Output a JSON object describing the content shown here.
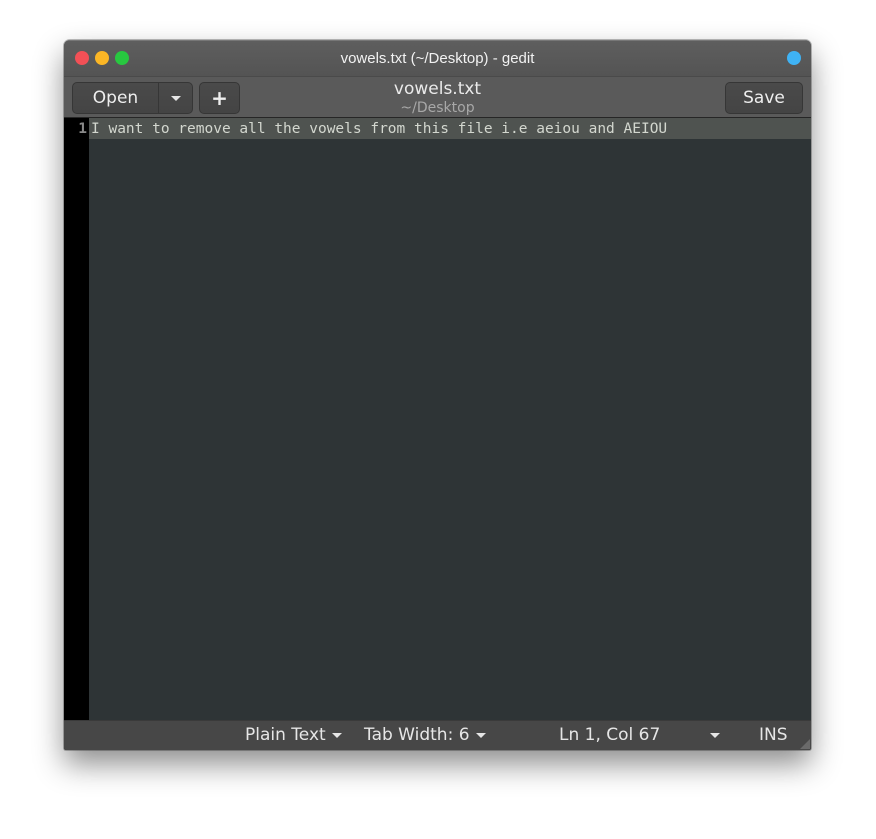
{
  "window": {
    "title": "vowels.txt (~/Desktop) - gedit",
    "controls": [
      "close",
      "minimize",
      "maximize"
    ]
  },
  "headerbar": {
    "open_label": "Open",
    "new_tab_label": "+",
    "save_label": "Save",
    "doc_title": "vowels.txt",
    "doc_path": "~/Desktop"
  },
  "editor": {
    "lines": [
      {
        "number": "1",
        "text": "I want to remove all the vowels from this file i.e aeiou and AEIOU"
      }
    ]
  },
  "statusbar": {
    "language": "Plain Text",
    "tab_width": "Tab Width: 6",
    "position": "Ln 1, Col 67",
    "mode": "INS"
  }
}
